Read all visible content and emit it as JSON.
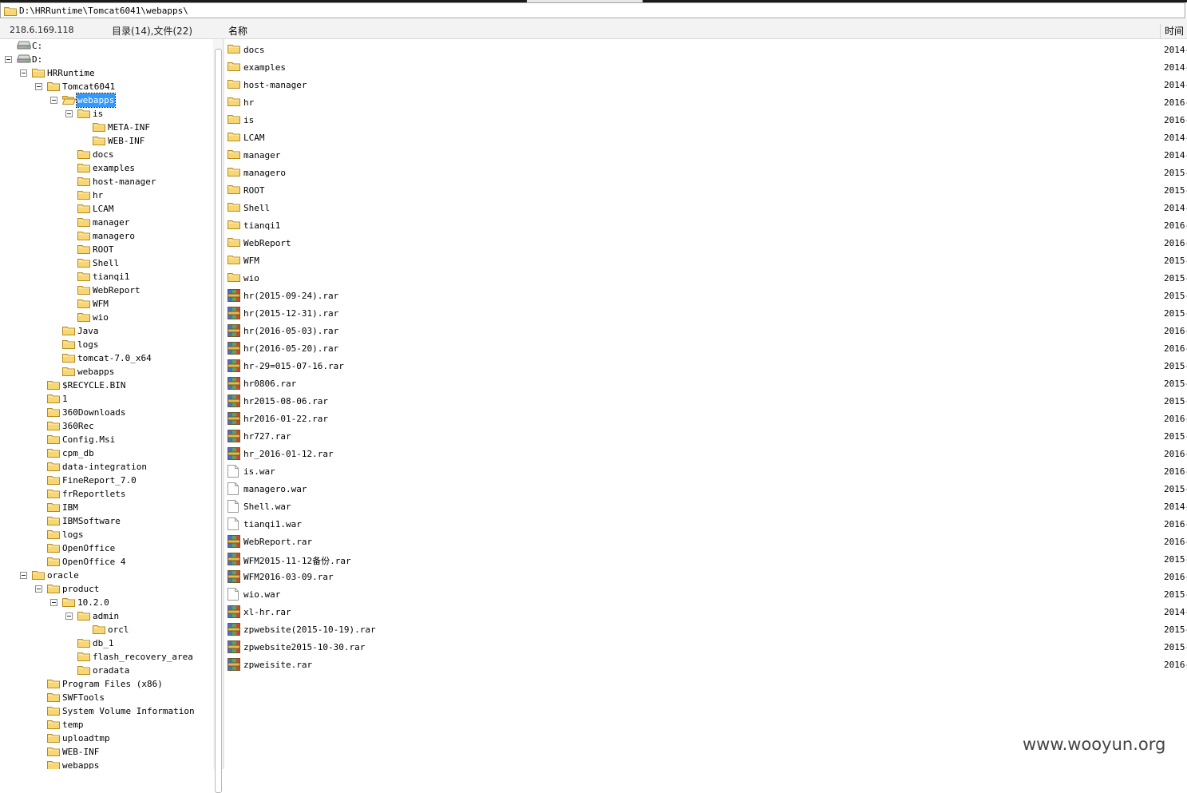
{
  "path_bar": {
    "path": "D:\\HRRuntime\\Tomcat6041\\webapps\\"
  },
  "header": {
    "ip": "218.6.169.118",
    "counts": "目录(14),文件(22)",
    "col_name": "名称",
    "col_time": "时间"
  },
  "tree": [
    {
      "label": "C:",
      "icon": "drive-icon",
      "level": 0,
      "toggle": false
    },
    {
      "label": "D:",
      "icon": "drive-icon",
      "level": 0,
      "toggle": true
    },
    {
      "label": "HRRuntime",
      "icon": "folder-icon",
      "level": 1,
      "toggle": true
    },
    {
      "label": "Tomcat6041",
      "icon": "folder-icon",
      "level": 2,
      "toggle": true
    },
    {
      "label": "webapps",
      "icon": "folder-open-icon",
      "level": 3,
      "toggle": true,
      "selected": true
    },
    {
      "label": "is",
      "icon": "folder-icon",
      "level": 4,
      "toggle": true
    },
    {
      "label": "META-INF",
      "icon": "folder-icon",
      "level": 5,
      "toggle": false
    },
    {
      "label": "WEB-INF",
      "icon": "folder-icon",
      "level": 5,
      "toggle": false
    },
    {
      "label": "docs",
      "icon": "folder-icon",
      "level": 4,
      "toggle": false
    },
    {
      "label": "examples",
      "icon": "folder-icon",
      "level": 4,
      "toggle": false
    },
    {
      "label": "host-manager",
      "icon": "folder-icon",
      "level": 4,
      "toggle": false
    },
    {
      "label": "hr",
      "icon": "folder-icon",
      "level": 4,
      "toggle": false
    },
    {
      "label": "LCAM",
      "icon": "folder-icon",
      "level": 4,
      "toggle": false
    },
    {
      "label": "manager",
      "icon": "folder-icon",
      "level": 4,
      "toggle": false
    },
    {
      "label": "managero",
      "icon": "folder-icon",
      "level": 4,
      "toggle": false
    },
    {
      "label": "ROOT",
      "icon": "folder-icon",
      "level": 4,
      "toggle": false
    },
    {
      "label": "Shell",
      "icon": "folder-icon",
      "level": 4,
      "toggle": false
    },
    {
      "label": "tianqi1",
      "icon": "folder-icon",
      "level": 4,
      "toggle": false
    },
    {
      "label": "WebReport",
      "icon": "folder-icon",
      "level": 4,
      "toggle": false
    },
    {
      "label": "WFM",
      "icon": "folder-icon",
      "level": 4,
      "toggle": false
    },
    {
      "label": "wio",
      "icon": "folder-icon",
      "level": 4,
      "toggle": false
    },
    {
      "label": "Java",
      "icon": "folder-icon",
      "level": 3,
      "toggle": false
    },
    {
      "label": "logs",
      "icon": "folder-icon",
      "level": 3,
      "toggle": false
    },
    {
      "label": "tomcat-7.0_x64",
      "icon": "folder-icon",
      "level": 3,
      "toggle": false
    },
    {
      "label": "webapps",
      "icon": "folder-icon",
      "level": 3,
      "toggle": false
    },
    {
      "label": "$RECYCLE.BIN",
      "icon": "folder-icon",
      "level": 2,
      "toggle": false
    },
    {
      "label": "1",
      "icon": "folder-icon",
      "level": 2,
      "toggle": false
    },
    {
      "label": "360Downloads",
      "icon": "folder-icon",
      "level": 2,
      "toggle": false
    },
    {
      "label": "360Rec",
      "icon": "folder-icon",
      "level": 2,
      "toggle": false
    },
    {
      "label": "Config.Msi",
      "icon": "folder-icon",
      "level": 2,
      "toggle": false
    },
    {
      "label": "cpm_db",
      "icon": "folder-icon",
      "level": 2,
      "toggle": false
    },
    {
      "label": "data-integration",
      "icon": "folder-icon",
      "level": 2,
      "toggle": false
    },
    {
      "label": "FineReport_7.0",
      "icon": "folder-icon",
      "level": 2,
      "toggle": false
    },
    {
      "label": "frReportlets",
      "icon": "folder-icon",
      "level": 2,
      "toggle": false
    },
    {
      "label": "IBM",
      "icon": "folder-icon",
      "level": 2,
      "toggle": false
    },
    {
      "label": "IBMSoftware",
      "icon": "folder-icon",
      "level": 2,
      "toggle": false
    },
    {
      "label": "logs",
      "icon": "folder-icon",
      "level": 2,
      "toggle": false
    },
    {
      "label": "OpenOffice",
      "icon": "folder-icon",
      "level": 2,
      "toggle": false
    },
    {
      "label": "OpenOffice 4",
      "icon": "folder-icon",
      "level": 2,
      "toggle": false
    },
    {
      "label": "oracle",
      "icon": "folder-icon",
      "level": 1,
      "toggle": true
    },
    {
      "label": "product",
      "icon": "folder-icon",
      "level": 2,
      "toggle": true
    },
    {
      "label": "10.2.0",
      "icon": "folder-icon",
      "level": 3,
      "toggle": true
    },
    {
      "label": "admin",
      "icon": "folder-icon",
      "level": 4,
      "toggle": true
    },
    {
      "label": "orcl",
      "icon": "folder-icon",
      "level": 5,
      "toggle": false
    },
    {
      "label": "db_1",
      "icon": "folder-icon",
      "level": 4,
      "toggle": false
    },
    {
      "label": "flash_recovery_area",
      "icon": "folder-icon",
      "level": 4,
      "toggle": false
    },
    {
      "label": "oradata",
      "icon": "folder-icon",
      "level": 4,
      "toggle": false
    },
    {
      "label": "Program Files (x86)",
      "icon": "folder-icon",
      "level": 2,
      "toggle": false
    },
    {
      "label": "SWFTools",
      "icon": "folder-icon",
      "level": 2,
      "toggle": false
    },
    {
      "label": "System Volume Information",
      "icon": "folder-icon",
      "level": 2,
      "toggle": false
    },
    {
      "label": "temp",
      "icon": "folder-icon",
      "level": 2,
      "toggle": false
    },
    {
      "label": "uploadtmp",
      "icon": "folder-icon",
      "level": 2,
      "toggle": false
    },
    {
      "label": "WEB-INF",
      "icon": "folder-icon",
      "level": 2,
      "toggle": false
    },
    {
      "label": "webapps",
      "icon": "folder-icon",
      "level": 2,
      "toggle": false
    }
  ],
  "files": [
    {
      "name": "docs",
      "type": "folder",
      "time": "2014-"
    },
    {
      "name": "examples",
      "type": "folder",
      "time": "2014-"
    },
    {
      "name": "host-manager",
      "type": "folder",
      "time": "2014-"
    },
    {
      "name": "hr",
      "type": "folder",
      "time": "2016-"
    },
    {
      "name": "is",
      "type": "folder",
      "time": "2016-"
    },
    {
      "name": "LCAM",
      "type": "folder",
      "time": "2014-"
    },
    {
      "name": "manager",
      "type": "folder",
      "time": "2014-"
    },
    {
      "name": "managero",
      "type": "folder",
      "time": "2015-"
    },
    {
      "name": "ROOT",
      "type": "folder",
      "time": "2015-"
    },
    {
      "name": "Shell",
      "type": "folder",
      "time": "2014-"
    },
    {
      "name": "tianqi1",
      "type": "folder",
      "time": "2016-"
    },
    {
      "name": "WebReport",
      "type": "folder",
      "time": "2016-"
    },
    {
      "name": "WFM",
      "type": "folder",
      "time": "2015-"
    },
    {
      "name": "wio",
      "type": "folder",
      "time": "2015-"
    },
    {
      "name": "hr(2015-09-24).rar",
      "type": "rar",
      "time": "2015-"
    },
    {
      "name": "hr(2015-12-31).rar",
      "type": "rar",
      "time": "2015-"
    },
    {
      "name": "hr(2016-05-03).rar",
      "type": "rar",
      "time": "2016-"
    },
    {
      "name": "hr(2016-05-20).rar",
      "type": "rar",
      "time": "2016-"
    },
    {
      "name": "hr-29=015-07-16.rar",
      "type": "rar",
      "time": "2015-"
    },
    {
      "name": "hr0806.rar",
      "type": "rar",
      "time": "2015-"
    },
    {
      "name": "hr2015-08-06.rar",
      "type": "rar",
      "time": "2015-"
    },
    {
      "name": "hr2016-01-22.rar",
      "type": "rar",
      "time": "2016-"
    },
    {
      "name": "hr727.rar",
      "type": "rar",
      "time": "2015-"
    },
    {
      "name": "hr_2016-01-12.rar",
      "type": "rar",
      "time": "2016-"
    },
    {
      "name": "is.war",
      "type": "file",
      "time": "2016-"
    },
    {
      "name": "managero.war",
      "type": "file",
      "time": "2015-"
    },
    {
      "name": "Shell.war",
      "type": "file",
      "time": "2014-"
    },
    {
      "name": "tianqi1.war",
      "type": "file",
      "time": "2016-"
    },
    {
      "name": "WebReport.rar",
      "type": "rar",
      "time": "2016-"
    },
    {
      "name": "WFM2015-11-12备份.rar",
      "type": "rar",
      "time": "2015-"
    },
    {
      "name": "WFM2016-03-09.rar",
      "type": "rar",
      "time": "2016-"
    },
    {
      "name": "wio.war",
      "type": "file",
      "time": "2015-"
    },
    {
      "name": "xl-hr.rar",
      "type": "rar",
      "time": "2014-"
    },
    {
      "name": "zpwebsite(2015-10-19).rar",
      "type": "rar",
      "time": "2015-"
    },
    {
      "name": "zpwebsite2015-10-30.rar",
      "type": "rar",
      "time": "2015-"
    },
    {
      "name": "zpweisite.rar",
      "type": "rar",
      "time": "2016-"
    }
  ],
  "watermark": "www.wooyun.org"
}
